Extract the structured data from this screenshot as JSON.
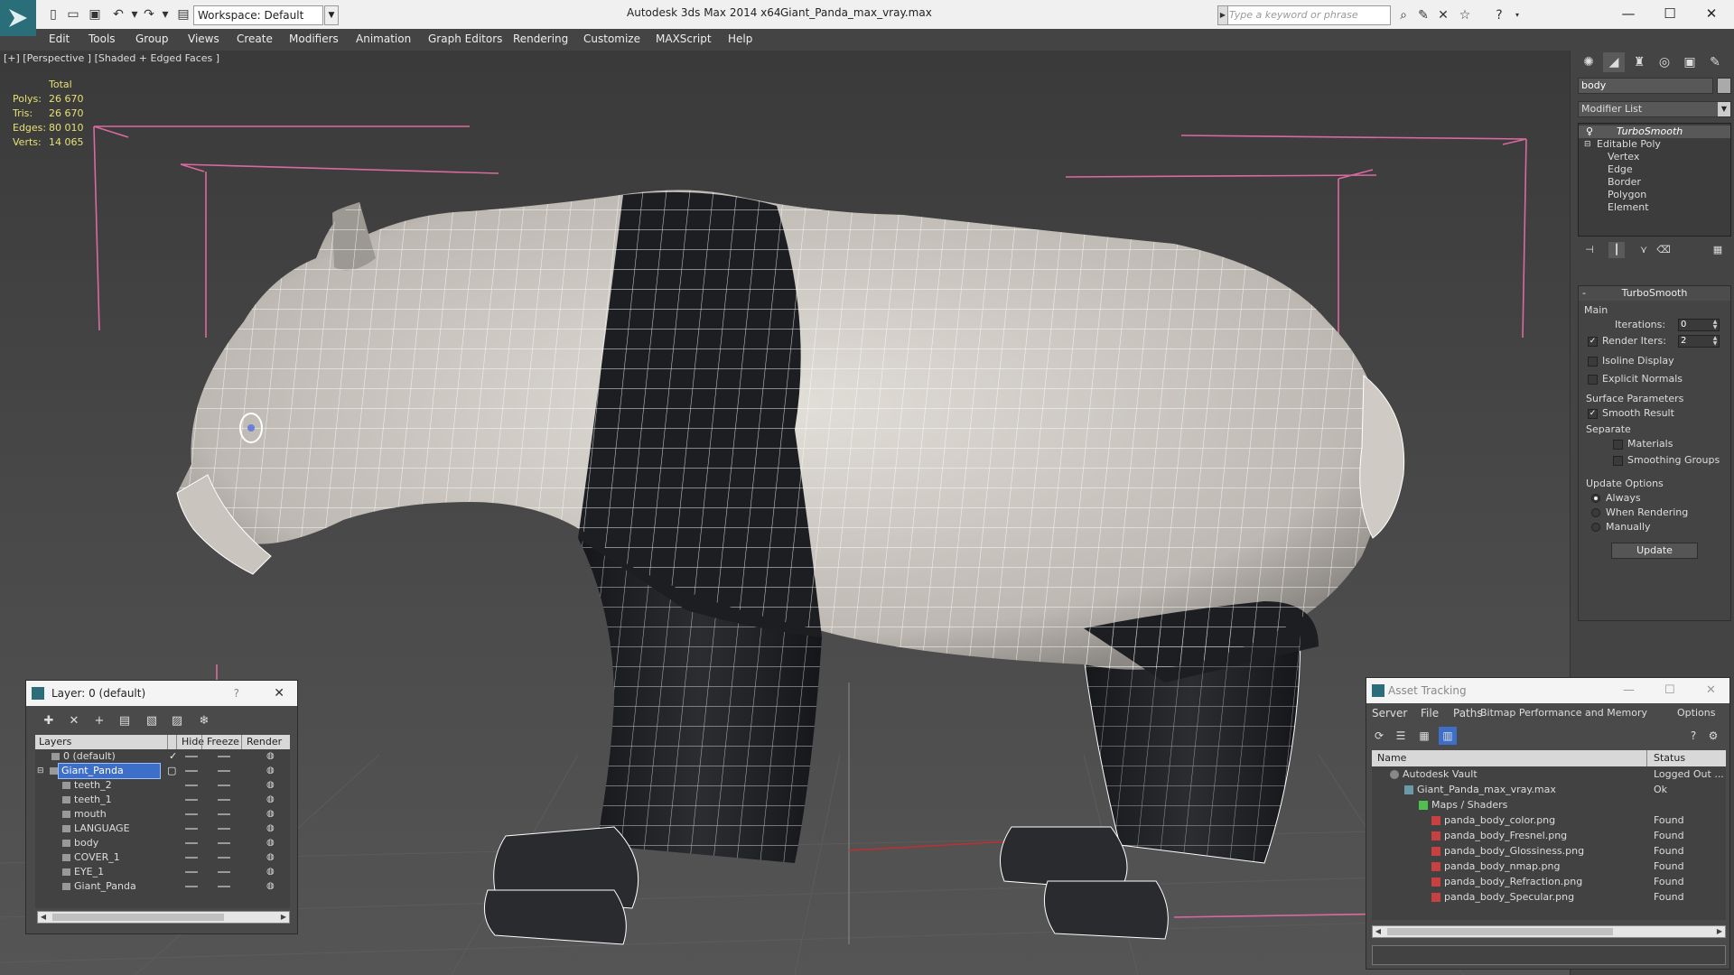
{
  "titlebar": {
    "workspace": "Workspace: Default",
    "app_title": "Autodesk 3ds Max  2014 x64",
    "file_title": "Giant_Panda_max_vray.max",
    "search_placeholder": "Type a keyword or phrase"
  },
  "menu": [
    "Edit",
    "Tools",
    "Group",
    "Views",
    "Create",
    "Modifiers",
    "Animation",
    "Graph Editors",
    "Rendering",
    "Customize",
    "MAXScript",
    "Help"
  ],
  "viewport": {
    "label": "[+] [Perspective ] [Shaded + Edged Faces ]",
    "stats": {
      "header": "Total",
      "rows": [
        {
          "label": "Polys:",
          "value": "26 670"
        },
        {
          "label": "Tris:",
          "value": "26 670"
        },
        {
          "label": "Edges:",
          "value": "80 010"
        },
        {
          "label": "Verts:",
          "value": "14 065"
        }
      ]
    },
    "colors": {
      "panda_white": "#dcd8d2",
      "panda_black": "#1e1f22",
      "wire": "#ffffff",
      "bbox": "#d96aa0"
    }
  },
  "command_panel": {
    "object_name": "body",
    "modifier_list": "Modifier List",
    "stack": [
      "TurboSmooth",
      "Editable Poly",
      "Vertex",
      "Edge",
      "Border",
      "Polygon",
      "Element"
    ],
    "turbosmooth": {
      "title": "TurboSmooth",
      "main_label": "Main",
      "iterations_label": "Iterations:",
      "iterations_value": "0",
      "render_iters_label": "Render Iters:",
      "render_iters_value": "2",
      "render_iters_checked": true,
      "isoline_label": "Isoline Display",
      "explicit_normals_label": "Explicit Normals",
      "surface_params_label": "Surface Parameters",
      "smooth_result_label": "Smooth Result",
      "separate_label": "Separate",
      "materials_label": "Materials",
      "smoothing_groups_label": "Smoothing Groups",
      "update_options_label": "Update Options",
      "always_label": "Always",
      "when_rendering_label": "When Rendering",
      "manually_label": "Manually",
      "update_button": "Update"
    }
  },
  "layer_window": {
    "title": "Layer: 0 (default)",
    "help": "?",
    "columns": [
      "Layers",
      "Hide",
      "Freeze",
      "Render"
    ],
    "rows": [
      "0 (default)",
      "Giant_Panda",
      "teeth_2",
      "teeth_1",
      "mouth",
      "LANGUAGE",
      "body",
      "COVER_1",
      "EYE_1",
      "Giant_Panda"
    ]
  },
  "asset_window": {
    "title": "Asset Tracking",
    "menu": [
      "Server",
      "File",
      "Paths",
      "Bitmap Performance and Memory",
      "Options"
    ],
    "columns": [
      "Name",
      "Status"
    ],
    "rows": [
      {
        "name": "Autodesk Vault",
        "status": "Logged Out ..."
      },
      {
        "name": "Giant_Panda_max_vray.max",
        "status": "Ok"
      },
      {
        "name": "Maps / Shaders",
        "status": ""
      },
      {
        "name": "panda_body_color.png",
        "status": "Found"
      },
      {
        "name": "panda_body_Fresnel.png",
        "status": "Found"
      },
      {
        "name": "panda_body_Glossiness.png",
        "status": "Found"
      },
      {
        "name": "panda_body_nmap.png",
        "status": "Found"
      },
      {
        "name": "panda_body_Refraction.png",
        "status": "Found"
      },
      {
        "name": "panda_body_Specular.png",
        "status": "Found"
      }
    ]
  }
}
